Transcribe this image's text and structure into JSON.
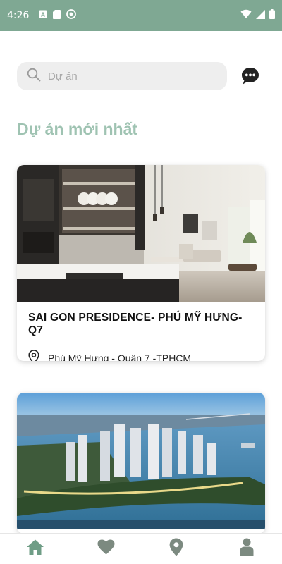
{
  "status_bar": {
    "time": "4:26",
    "left_icons": [
      "a-notification-icon",
      "sd-card-icon",
      "sync-icon"
    ],
    "right_icons": [
      "wifi-icon",
      "signal-icon",
      "battery-icon"
    ]
  },
  "search": {
    "placeholder": "Dự án",
    "value": ""
  },
  "chat_icon": "chat-bubble-icon",
  "section": {
    "title": "Dự án mới nhất"
  },
  "projects": [
    {
      "title": "SAI GON PRESIDENCE- PHÚ MỸ HƯNG- Q7",
      "location": "Phú Mỹ Hưng - Quận 7 -TPHCM",
      "image": "kitchen-living-room-interior"
    },
    {
      "title": "",
      "location": "",
      "image": "riverside-towers-aerial"
    }
  ],
  "bottom_nav": {
    "items": [
      "home-icon",
      "heart-icon",
      "location-pin-icon",
      "profile-icon"
    ],
    "active": "home-icon"
  },
  "colors": {
    "status_bar": "#7fa893",
    "accent": "#9fc3b2",
    "nav_active": "#6f9d86",
    "nav_inactive": "#7c8a80",
    "search_bg": "#eeeeee"
  }
}
